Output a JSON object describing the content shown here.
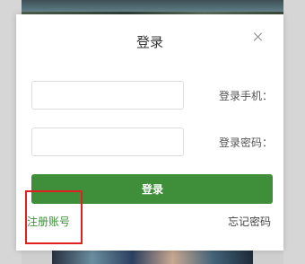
{
  "dialog": {
    "title": "登录",
    "close_icon": "close-icon"
  },
  "form": {
    "phone_label": "登录手机：",
    "phone_value": "",
    "phone_placeholder": "",
    "password_label": "登录密码：",
    "password_value": "",
    "password_placeholder": "",
    "login_button_label": "登录"
  },
  "links": {
    "forgot_password": "忘记密码",
    "register": "注册账号"
  },
  "colors": {
    "accent_green": "#3f8e3a",
    "highlight_red": "#e02020",
    "border_gray": "#dcdcdc"
  },
  "layout_note": "page rendered horizontally mirrored"
}
